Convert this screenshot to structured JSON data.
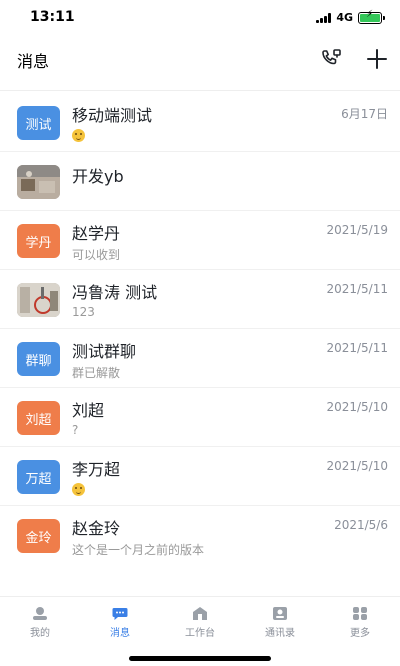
{
  "status_bar": {
    "time": "13:11",
    "network": "4G"
  },
  "header": {
    "title": "消息"
  },
  "conversations": [
    {
      "avatar_text": "测试",
      "avatar_color": "#4a90e2",
      "name": "移动端测试",
      "time": "6月17日",
      "preview_icon": "emoji-shocked-icon"
    },
    {
      "avatar_text": "",
      "avatar_color": "#a9a39a",
      "name": "开发yb",
      "time": "",
      "preview": ""
    },
    {
      "avatar_text": "学丹",
      "avatar_color": "#ef7d4a",
      "name": "赵学丹",
      "time": "2021/5/19",
      "preview": "可以收到"
    },
    {
      "avatar_text": "",
      "avatar_color": "#a9a39a",
      "name": "冯鲁涛 测试",
      "time": "2021/5/11",
      "preview": "123"
    },
    {
      "avatar_text": "群聊",
      "avatar_color": "#4a90e2",
      "name": "测试群聊",
      "time": "2021/5/11",
      "preview": "群已解散"
    },
    {
      "avatar_text": "刘超",
      "avatar_color": "#ef7d4a",
      "name": "刘超",
      "time": "2021/5/10",
      "preview": "?"
    },
    {
      "avatar_text": "万超",
      "avatar_color": "#4a90e2",
      "name": "李万超",
      "time": "2021/5/10",
      "preview_icon": "emoji-grin-icon"
    },
    {
      "avatar_text": "金玲",
      "avatar_color": "#ef7d4a",
      "name": "赵金玲",
      "time": "2021/5/6",
      "preview": "这个是一个月之前的版本"
    }
  ],
  "tabs": [
    {
      "label": "我的",
      "icon": "profile-icon",
      "active": false
    },
    {
      "label": "消息",
      "icon": "message-icon",
      "active": true
    },
    {
      "label": "工作台",
      "icon": "workbench-icon",
      "active": false
    },
    {
      "label": "通讯录",
      "icon": "contacts-icon",
      "active": false
    },
    {
      "label": "更多",
      "icon": "more-grid-icon",
      "active": false
    }
  ],
  "colors": {
    "accent": "#3a7fe6",
    "orange_avatar": "#ef7d4a",
    "blue_avatar": "#4a90e2",
    "battery": "#34c759"
  }
}
